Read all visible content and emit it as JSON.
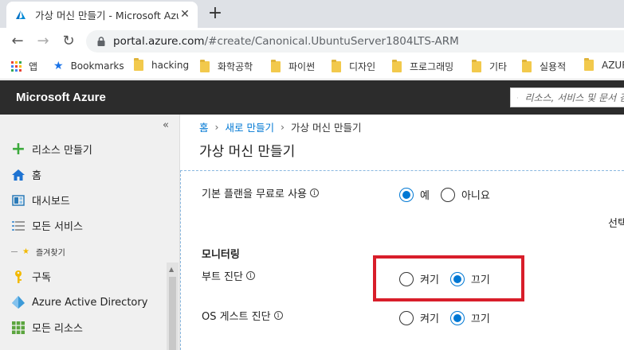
{
  "browser": {
    "tab_title": "가상 머신 만들기 - Microsoft Azure",
    "url_host": "portal.azure.com",
    "url_path": "/#create/Canonical.UbuntuServer1804LTS-ARM",
    "bookmarks": [
      "앱",
      "Bookmarks",
      "hacking",
      "화학공학",
      "파이썬",
      "디자인",
      "프로그래밍",
      "기타",
      "실용적",
      "AZURE"
    ]
  },
  "azure": {
    "brand": "Microsoft Azure",
    "search_placeholder": "리소스, 서비스 및 문서 검색"
  },
  "sidebar": {
    "items": [
      {
        "label": "리소스 만들기",
        "icon": "plus-icon"
      },
      {
        "label": "홈",
        "icon": "home-icon"
      },
      {
        "label": "대시보드",
        "icon": "dashboard-icon"
      },
      {
        "label": "모든 서비스",
        "icon": "list-icon"
      },
      {
        "label": "구독",
        "icon": "key-icon"
      },
      {
        "label": "Azure Active Directory",
        "icon": "aad-icon"
      },
      {
        "label": "모든 리소스",
        "icon": "grid-icon"
      }
    ],
    "favorites_header": "즐겨찾기"
  },
  "main": {
    "breadcrumb": [
      "홈",
      "새로 만들기",
      "가상 머신 만들기"
    ],
    "title": "가상 머신 만들기",
    "basic_plan": {
      "label": "기본 플랜을 무료로 사용",
      "options": [
        "예",
        "아니요"
      ],
      "selected": "예"
    },
    "select_text": "선택",
    "section": "모니터링",
    "boot_diag": {
      "label": "부트 진단",
      "options": [
        "켜기",
        "끄기"
      ],
      "selected": "끄기"
    },
    "os_diag": {
      "label": "OS 게스트 진단",
      "options": [
        "켜기",
        "끄기"
      ],
      "selected": "끄기"
    }
  },
  "colors": {
    "accent": "#0078d4",
    "highlight": "#d81e2a",
    "header": "#2c2c2c"
  }
}
